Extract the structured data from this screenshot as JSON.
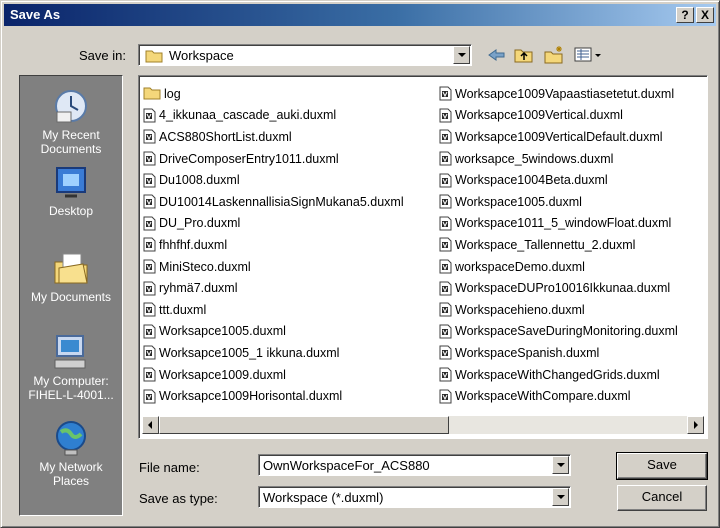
{
  "window": {
    "title": "Save As",
    "help_label": "?",
    "close_label": "X"
  },
  "savein": {
    "label": "Save in:",
    "value": "Workspace"
  },
  "places": [
    {
      "label": "My Recent Documents",
      "icon": "recent-documents-icon"
    },
    {
      "label": "Desktop",
      "icon": "desktop-icon"
    },
    {
      "label": "My Documents",
      "icon": "my-documents-icon"
    },
    {
      "label": "My Computer: FIHEL-L-4001...",
      "icon": "my-computer-icon"
    },
    {
      "label": "My Network Places",
      "icon": "network-places-icon"
    }
  ],
  "files": {
    "col1": [
      {
        "name": "log",
        "type": "folder"
      },
      {
        "name": "4_ikkunaa_cascade_auki.duxml",
        "type": "file"
      },
      {
        "name": "ACS880ShortList.duxml",
        "type": "file"
      },
      {
        "name": "DriveComposerEntry1011.duxml",
        "type": "file"
      },
      {
        "name": "Du1008.duxml",
        "type": "file"
      },
      {
        "name": "DU10014LaskennallisiaSignMukana5.duxml",
        "type": "file"
      },
      {
        "name": "DU_Pro.duxml",
        "type": "file"
      },
      {
        "name": "fhhfhf.duxml",
        "type": "file"
      },
      {
        "name": "MiniSteco.duxml",
        "type": "file"
      },
      {
        "name": "ryhmä7.duxml",
        "type": "file"
      },
      {
        "name": "ttt.duxml",
        "type": "file"
      },
      {
        "name": "Worksapce1005.duxml",
        "type": "file"
      },
      {
        "name": "Worksapce1005_1 ikkuna.duxml",
        "type": "file"
      },
      {
        "name": "Worksapce1009.duxml",
        "type": "file"
      },
      {
        "name": "Worksapce1009Horisontal.duxml",
        "type": "file"
      }
    ],
    "col2": [
      {
        "name": "Worksapce1009Vapaastiasetetut.duxml",
        "type": "file"
      },
      {
        "name": "Worksapce1009Vertical.duxml",
        "type": "file"
      },
      {
        "name": "Worksapce1009VerticalDefault.duxml",
        "type": "file"
      },
      {
        "name": "worksapce_5windows.duxml",
        "type": "file"
      },
      {
        "name": "Workspace1004Beta.duxml",
        "type": "file"
      },
      {
        "name": "Workspace1005.duxml",
        "type": "file"
      },
      {
        "name": "Workspace1011_5_windowFloat.duxml",
        "type": "file"
      },
      {
        "name": "Workspace_Tallennettu_2.duxml",
        "type": "file"
      },
      {
        "name": "workspaceDemo.duxml",
        "type": "file"
      },
      {
        "name": "WorkspaceDUPro10016Ikkunaa.duxml",
        "type": "file"
      },
      {
        "name": "Workspacehieno.duxml",
        "type": "file"
      },
      {
        "name": "WorkspaceSaveDuringMonitoring.duxml",
        "type": "file"
      },
      {
        "name": "WorkspaceSpanish.duxml",
        "type": "file"
      },
      {
        "name": "WorkspaceWithChangedGrids.duxml",
        "type": "file"
      },
      {
        "name": "WorkspaceWithCompare.duxml",
        "type": "file"
      }
    ]
  },
  "filename": {
    "label": "File name:",
    "value": "OwnWorkspaceFor_ACS880"
  },
  "filetype": {
    "label": "Save as type:",
    "value": "Workspace (*.duxml)"
  },
  "buttons": {
    "save": "Save",
    "cancel": "Cancel"
  }
}
